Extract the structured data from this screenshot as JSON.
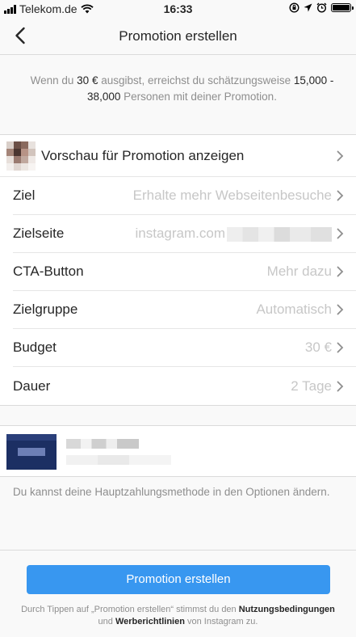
{
  "status_bar": {
    "carrier": "Telekom.de",
    "time": "16:33",
    "battery_level": 1.0
  },
  "nav": {
    "title": "Promotion erstellen",
    "back_icon": "chevron-left-icon"
  },
  "summary": {
    "prefix": "Wenn du ",
    "amount": "30 €",
    "middle": " ausgibst, erreichst du schätzungsweise ",
    "range": "15,000 - 38,000",
    "suffix": " Personen mit deiner Promotion."
  },
  "settings": {
    "preview_label": "Vorschau für Promotion anzeigen",
    "rows": [
      {
        "label": "Ziel",
        "value": "Erhalte mehr Webseitenbesuche"
      },
      {
        "label": "Zielseite",
        "value": "instagram.com"
      },
      {
        "label": "CTA-Button",
        "value": "Mehr dazu"
      },
      {
        "label": "Zielgruppe",
        "value": "Automatisch"
      },
      {
        "label": "Budget",
        "value": "30 €"
      },
      {
        "label": "Dauer",
        "value": "2 Tage"
      }
    ]
  },
  "payment": {
    "note": "Du kannst deine Hauptzahlungsmethode in den Optionen ändern."
  },
  "footer": {
    "button_label": "Promotion erstellen",
    "terms_prefix": "Durch Tippen auf „Promotion erstellen“ stimmst du den ",
    "terms_link1": "Nutzungsbedingungen",
    "terms_and": " und ",
    "terms_link2": "Werberichtlinien",
    "terms_suffix": " von Instagram zu."
  },
  "colors": {
    "accent": "#3897f0",
    "text": "#262626",
    "secondary_text": "#8e8e8e",
    "value_text": "#c7c7c7"
  }
}
